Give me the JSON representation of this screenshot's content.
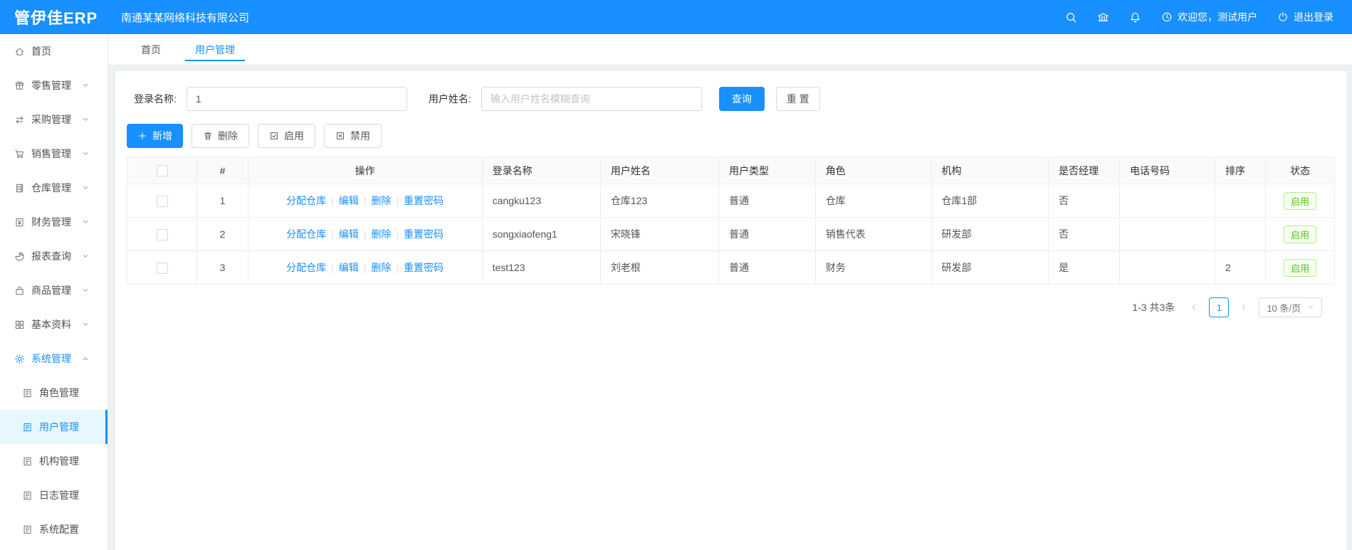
{
  "topbar": {
    "logo": "管伊佳ERP",
    "company": "南通某某网络科技有限公司",
    "welcome": "欢迎您，测试用户",
    "logout": "退出登录"
  },
  "sidebar": {
    "items": [
      {
        "label": "首页",
        "icon": "home"
      },
      {
        "label": "零售管理",
        "icon": "gift",
        "chevron": "down"
      },
      {
        "label": "采购管理",
        "icon": "swap",
        "chevron": "down"
      },
      {
        "label": "销售管理",
        "icon": "cart",
        "chevron": "down"
      },
      {
        "label": "仓库管理",
        "icon": "warehouse",
        "chevron": "down"
      },
      {
        "label": "财务管理",
        "icon": "finance",
        "chevron": "down"
      },
      {
        "label": "报表查询",
        "icon": "pie",
        "chevron": "down"
      },
      {
        "label": "商品管理",
        "icon": "bag",
        "chevron": "down"
      },
      {
        "label": "基本资料",
        "icon": "grid",
        "chevron": "down"
      },
      {
        "label": "系统管理",
        "icon": "gear",
        "chevron": "up",
        "active": true
      },
      {
        "label": "角色管理",
        "icon": "doc",
        "sub": true
      },
      {
        "label": "用户管理",
        "icon": "doc",
        "sub": true,
        "selected": true
      },
      {
        "label": "机构管理",
        "icon": "doc",
        "sub": true
      },
      {
        "label": "日志管理",
        "icon": "doc",
        "sub": true
      },
      {
        "label": "系统配置",
        "icon": "doc",
        "sub": true
      }
    ]
  },
  "tabs": [
    {
      "label": "首页"
    },
    {
      "label": "用户管理",
      "active": true
    }
  ],
  "filter": {
    "login_label": "登录名称:",
    "login_value": "1",
    "name_label": "用户姓名:",
    "name_placeholder": "输入用户姓名模糊查询",
    "search_button": "查询",
    "reset_button": "重 置"
  },
  "toolbar": {
    "add": "新增",
    "delete": "删除",
    "enable": "启用",
    "disable": "禁用"
  },
  "table": {
    "headers": [
      "#",
      "操作",
      "登录名称",
      "用户姓名",
      "用户类型",
      "角色",
      "机构",
      "是否经理",
      "电话号码",
      "排序",
      "状态"
    ],
    "op_links": [
      "分配仓库",
      "编辑",
      "删除",
      "重置密码"
    ],
    "rows": [
      {
        "index": "1",
        "login": "cangku123",
        "name": "仓库123",
        "type": "普通",
        "role": "仓库",
        "org": "仓库1部",
        "manager": "否",
        "phone": "",
        "sort": "",
        "status": "启用"
      },
      {
        "index": "2",
        "login": "songxiaofeng1",
        "name": "宋晓锋",
        "type": "普通",
        "role": "销售代表",
        "org": "研发部",
        "manager": "否",
        "phone": "",
        "sort": "",
        "status": "启用"
      },
      {
        "index": "3",
        "login": "test123",
        "name": "刘老根",
        "type": "普通",
        "role": "财务",
        "org": "研发部",
        "manager": "是",
        "phone": "",
        "sort": "2",
        "status": "启用"
      }
    ]
  },
  "pagination": {
    "total": "1-3 共3条",
    "page": "1",
    "page_size": "10 条/页"
  },
  "colors": {
    "primary": "#1890ff",
    "status_green": "#52c41a"
  }
}
